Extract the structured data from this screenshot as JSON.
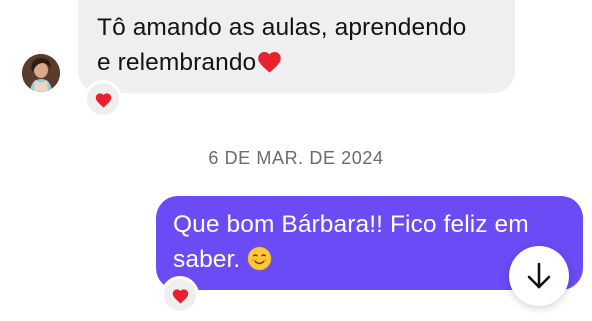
{
  "thread": {
    "incoming_message": {
      "text": "Tô amando as aulas, aprendendo e relembrando",
      "line1": "Tô amando as aulas, aprendendo",
      "line2": "e relembrando",
      "trailing_emoji": "red-heart-emoji",
      "reaction": "red-heart-emoji"
    },
    "date_separator": "6 DE MAR. DE 2024",
    "outgoing_message": {
      "text": "Que bom Bárbara!! Fico feliz em saber.",
      "line1": "Que bom Bárbara!! Fico feliz em",
      "line2": "saber.",
      "trailing_emoji": "smiling-face-emoji",
      "reaction": "red-heart-emoji"
    }
  },
  "controls": {
    "scroll_to_bottom_icon": "arrow-down-icon"
  },
  "colors": {
    "incoming_bubble": "#efefef",
    "outgoing_bubble": "#6a4bf5",
    "heart": "#e8212e",
    "date_text": "#6b6b6b"
  }
}
